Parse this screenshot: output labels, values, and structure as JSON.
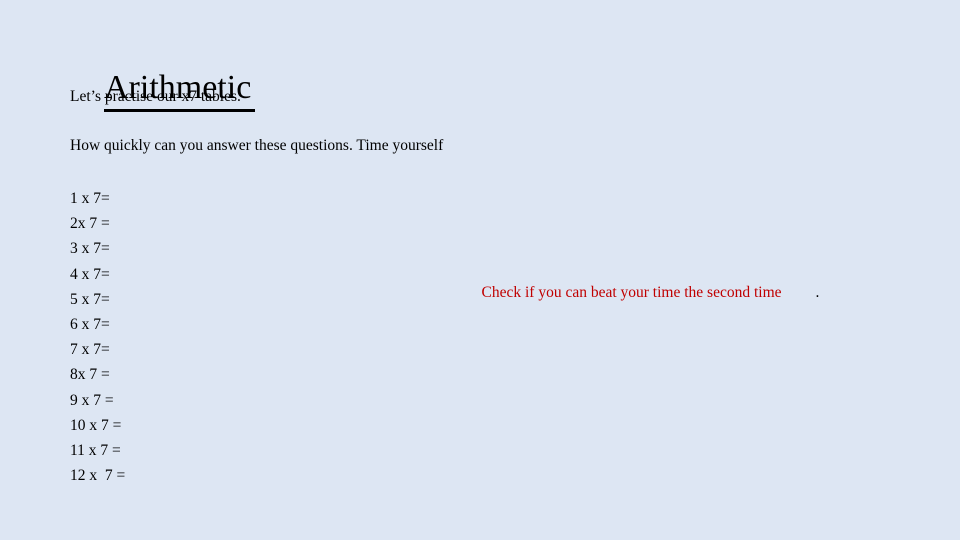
{
  "slide": {
    "title": "Arithmetic",
    "background_color": "#dde6f3",
    "text_color": "#000000",
    "accent_color": "#c00000",
    "intro_line_1": "Let’s practise our x7 tables.",
    "intro_line_2": "How quickly can you answer these questions. Time yourself",
    "questions": [
      "1 x 7=",
      "2x 7 =",
      "3 x 7=",
      "4 x 7=",
      "5 x 7=",
      "6 x 7=",
      "7 x 7=",
      "8x 7 =",
      "9 x 7 =",
      "10 x 7 =",
      "11 x 7 =",
      "12 x  7 ="
    ],
    "note": {
      "text": "Check if you can beat your time the second time",
      "trailing_period": "."
    }
  }
}
